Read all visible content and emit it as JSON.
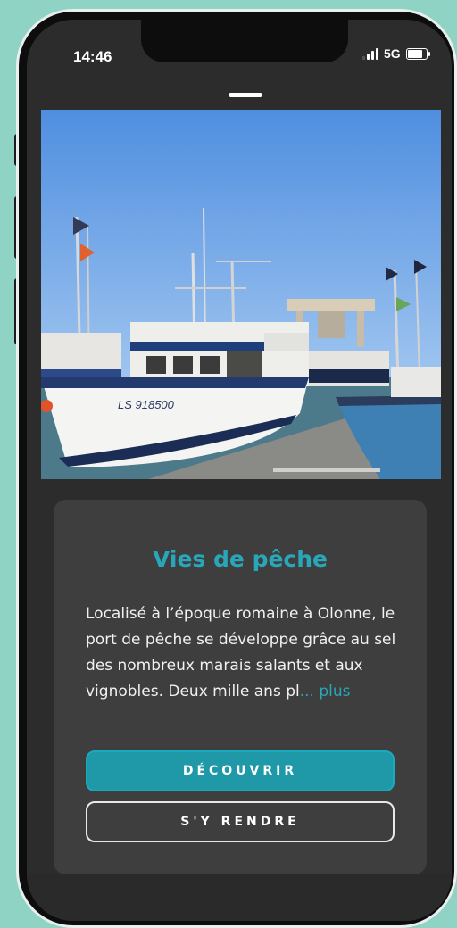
{
  "status_bar": {
    "time": "14:46",
    "network": "5G"
  },
  "card": {
    "title": "Vies de pêche",
    "description": "Localisé à l’époque romaine à Olonne, le port de pêche se développe grâce au sel des nombreux marais salants et aux vignobles. Deux mille ans pl",
    "more_link": "... plus",
    "discover_button": "DÉCOUVRIR",
    "directions_button": "S'Y RENDRE"
  },
  "photo": {
    "boat_registration": "LS 918500"
  },
  "colors": {
    "accent": "#29a7b8",
    "button_primary": "#1f98a8",
    "background": "#8fd3c4",
    "card": "#3e3e3e"
  }
}
